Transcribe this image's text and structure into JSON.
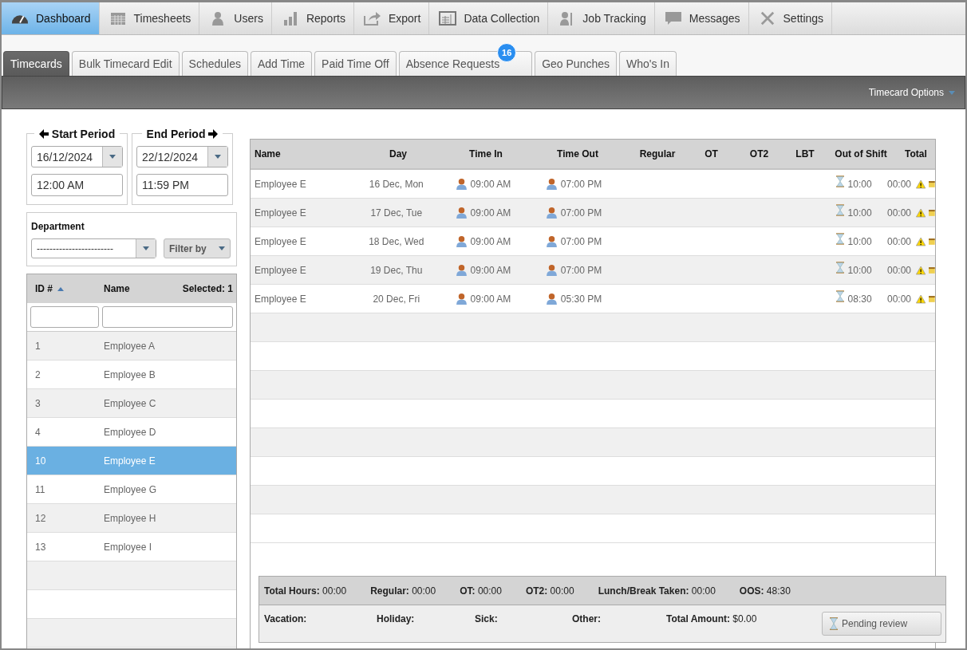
{
  "nav": [
    {
      "label": "Dashboard",
      "selected": true
    },
    {
      "label": "Timesheets",
      "selected": false
    },
    {
      "label": "Users",
      "selected": false
    },
    {
      "label": "Reports",
      "selected": false
    },
    {
      "label": "Export",
      "selected": false
    },
    {
      "label": "Data Collection",
      "selected": false
    },
    {
      "label": "Job Tracking",
      "selected": false
    },
    {
      "label": "Messages",
      "selected": false
    },
    {
      "label": "Settings",
      "selected": false
    }
  ],
  "tabs": [
    {
      "label": "Timecards",
      "selected": true
    },
    {
      "label": "Bulk Timecard Edit",
      "selected": false
    },
    {
      "label": "Schedules",
      "selected": false
    },
    {
      "label": "Add Time",
      "selected": false
    },
    {
      "label": "Paid Time Off",
      "selected": false
    },
    {
      "label": "Absence Requests",
      "selected": false,
      "badge": "16"
    },
    {
      "label": "Geo Punches",
      "selected": false
    },
    {
      "label": "Who's In",
      "selected": false
    }
  ],
  "toolbar": {
    "options": "Timecard Options"
  },
  "period": {
    "start_label": "Start Period",
    "end_label": "End Period",
    "start_date": "16/12/2024",
    "end_date": "22/12/2024",
    "start_time": "12:00 AM",
    "end_time": "11:59 PM"
  },
  "department": {
    "label": "Department",
    "value": "------------------------",
    "filter": "Filter by"
  },
  "employees": {
    "columns": [
      "ID #",
      "Name"
    ],
    "selected_count": "Selected: 1",
    "rows": [
      {
        "id": "1",
        "name": "Employee A",
        "selected": false
      },
      {
        "id": "2",
        "name": "Employee B",
        "selected": false
      },
      {
        "id": "3",
        "name": "Employee C",
        "selected": false
      },
      {
        "id": "4",
        "name": "Employee D",
        "selected": false
      },
      {
        "id": "10",
        "name": "Employee E",
        "selected": true
      },
      {
        "id": "11",
        "name": "Employee G",
        "selected": false
      },
      {
        "id": "12",
        "name": "Employee H",
        "selected": false
      },
      {
        "id": "13",
        "name": "Employee I",
        "selected": false
      }
    ]
  },
  "timecard": {
    "columns": [
      "Name",
      "Day",
      "Time In",
      "Time Out",
      "Regular",
      "OT",
      "OT2",
      "LBT",
      "Out of Shift",
      "Total"
    ],
    "rows": [
      {
        "name": "Employee E",
        "day": "16 Dec, Mon",
        "time_in": "09:00 AM",
        "time_out": "07:00 PM",
        "out_of_shift": "10:00",
        "total": "00:00"
      },
      {
        "name": "Employee E",
        "day": "17 Dec, Tue",
        "time_in": "09:00 AM",
        "time_out": "07:00 PM",
        "out_of_shift": "10:00",
        "total": "00:00"
      },
      {
        "name": "Employee E",
        "day": "18 Dec, Wed",
        "time_in": "09:00 AM",
        "time_out": "07:00 PM",
        "out_of_shift": "10:00",
        "total": "00:00"
      },
      {
        "name": "Employee E",
        "day": "19 Dec, Thu",
        "time_in": "09:00 AM",
        "time_out": "07:00 PM",
        "out_of_shift": "10:00",
        "total": "00:00"
      },
      {
        "name": "Employee E",
        "day": "20 Dec, Fri",
        "time_in": "09:00 AM",
        "time_out": "05:30 PM",
        "out_of_shift": "08:30",
        "total": "00:00"
      }
    ]
  },
  "summary": {
    "totals": [
      "**Total Hours:** 00:00",
      "**Regular:** 00:00",
      "**OT:** 00:00",
      "**OT2:** 00:00",
      "**Lunch/Break Taken:** 00:00",
      "**OOS:** 48:30"
    ],
    "leave": [
      "Vacation:",
      "Holiday:",
      "Sick:",
      "Other:",
      "**Total Amount:** $0.00"
    ],
    "status_button": "Pending review"
  }
}
